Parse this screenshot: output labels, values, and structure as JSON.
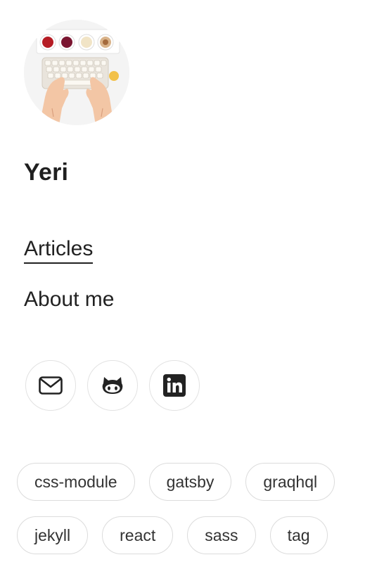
{
  "author": {
    "name": "Yeri",
    "avatar_icon": "avatar-photo-keyboard"
  },
  "nav": {
    "items": [
      {
        "label": "Articles",
        "active": true
      },
      {
        "label": "About me",
        "active": false
      }
    ]
  },
  "socials": [
    {
      "name": "email",
      "icon": "mail-icon"
    },
    {
      "name": "github",
      "icon": "github-icon"
    },
    {
      "name": "linkedin",
      "icon": "linkedin-icon"
    }
  ],
  "tags": [
    "css-module",
    "gatsby",
    "graqhql",
    "jekyll",
    "react",
    "sass",
    "tag"
  ],
  "colors": {
    "text": "#222222",
    "border": "#dcdcdc"
  }
}
